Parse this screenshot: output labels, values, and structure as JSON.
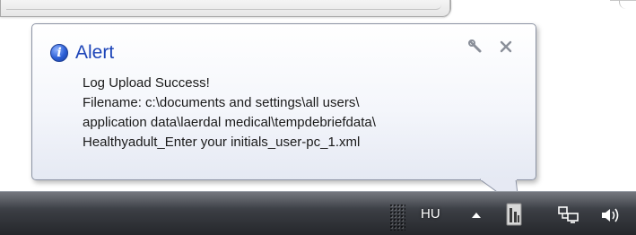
{
  "notification": {
    "title": "Alert",
    "icons": {
      "title": "info-icon",
      "options": "wrench-icon",
      "close": "close-icon"
    },
    "message_lines": [
      "Log Upload Success!",
      "Filename: c:\\documents and settings\\all users\\",
      "application data\\laerdal medical\\tempdebriefdata\\",
      "Healthyadult_Enter your initials_user-pc_1.xml"
    ]
  },
  "taskbar": {
    "language": "HU",
    "tray_icons": [
      "show-hidden-icons-arrow",
      "application-tray-icon",
      "network-icon",
      "volume-icon"
    ]
  },
  "colors": {
    "title": "#1c44b8",
    "taskbar_top": "#5a5e66",
    "taskbar_bottom": "#25272b",
    "balloon_border": "#8c93a4"
  }
}
